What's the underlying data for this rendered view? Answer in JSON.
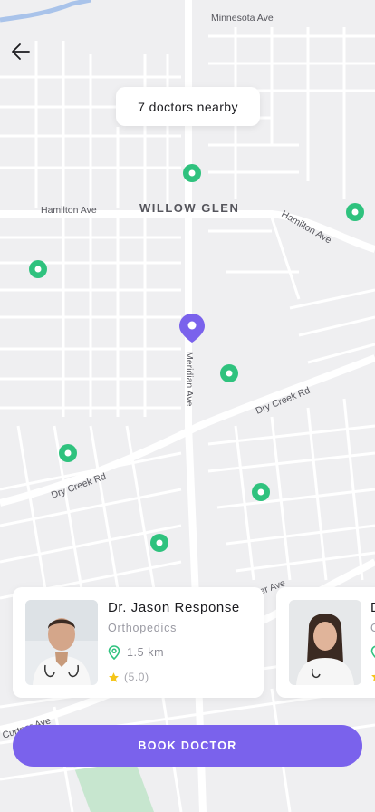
{
  "map": {
    "streets": {
      "minnesota": "Minnesota Ave",
      "hamilton_left": "Hamilton Ave",
      "hamilton_right": "Hamilton Ave",
      "meridian": "Meridian Ave",
      "dry_creek_right": "Dry Creek Rd",
      "dry_creek_left": "Dry Creek Rd",
      "curtner_top": "er Ave",
      "curtner_bottom": "Curtner Ave"
    },
    "area_label": "WILLOW GLEN",
    "marker_color": "#2fc27e",
    "location_pin_color": "#7a62ec"
  },
  "nearby_pill": "7 doctors nearby",
  "doctors": [
    {
      "name": "Dr. Jason Response",
      "specialty": "Orthopedics",
      "distance": "1.5 km",
      "rating": "(5.0)"
    },
    {
      "name": "D",
      "specialty": "O",
      "distance": "",
      "rating": ""
    }
  ],
  "book_button": "BOOK DOCTOR",
  "icons": {
    "back": "arrow-left-icon",
    "distance": "location-pin-icon",
    "rating": "star-icon"
  },
  "colors": {
    "accent": "#7a62ec",
    "star": "#f5c518",
    "distance_icon": "#2fc27e"
  }
}
